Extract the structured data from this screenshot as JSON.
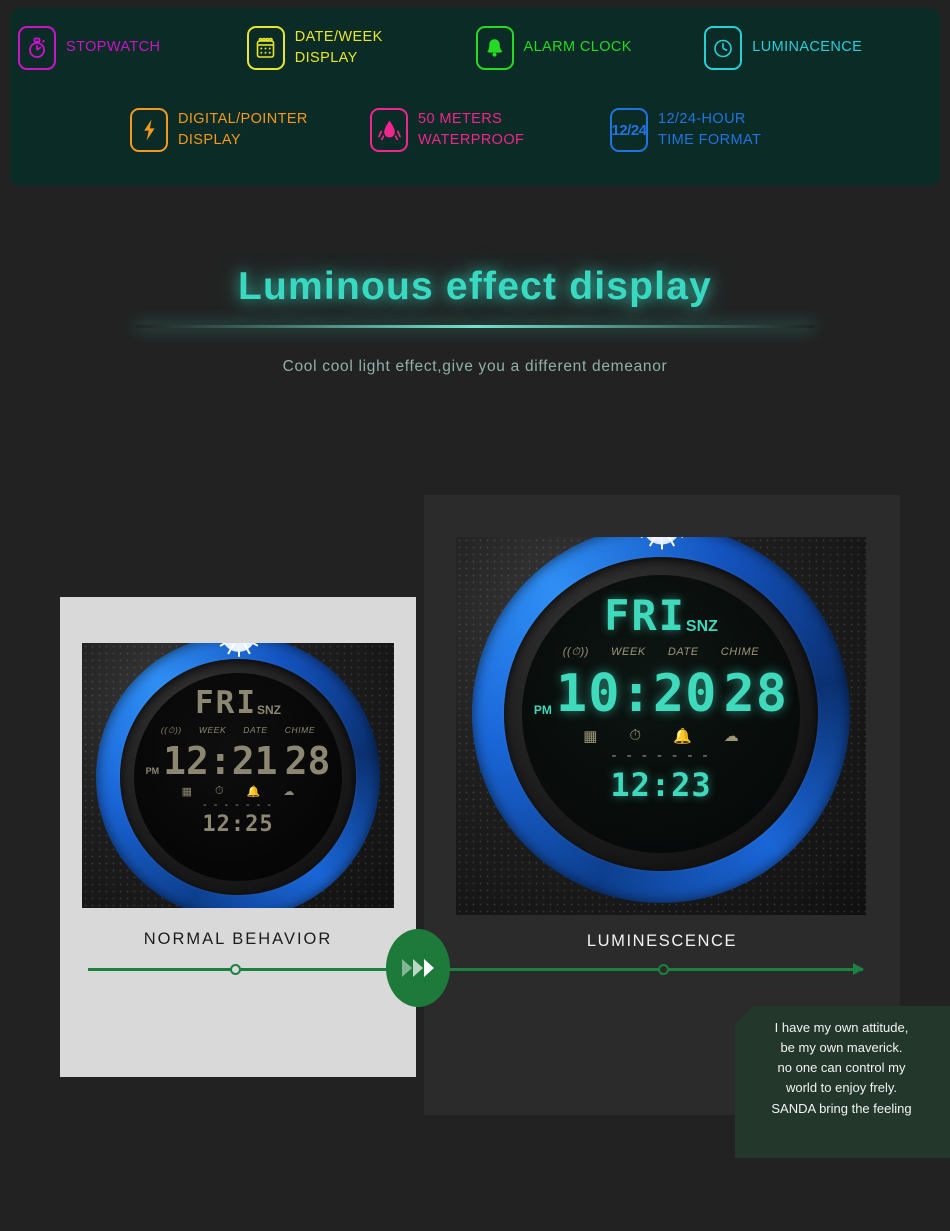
{
  "banner": {
    "features_row1": [
      {
        "icon": "stopwatch-icon",
        "label": "STOPWATCH",
        "color": "#c715c7"
      },
      {
        "icon": "calendar-icon",
        "label": "DATE/WEEK\nDISPLAY",
        "color": "#e8e62a"
      },
      {
        "icon": "bell-icon",
        "label": "ALARM CLOCK",
        "color": "#25d925"
      },
      {
        "icon": "clock-icon",
        "label": "LUMINACENCE",
        "color": "#27cfd6"
      }
    ],
    "features_row2": [
      {
        "icon": "lightning-bolt-icon",
        "label": "DIGITAL/POINTER\nDISPLAY",
        "color": "#f2991f"
      },
      {
        "icon": "water-drop-icon",
        "label": "50 METERS\nWATERPROOF",
        "color": "#f0268c"
      },
      {
        "icon": "twelve-twentyfour-icon",
        "label": "12/24-HOUR\nTIME FORMAT",
        "color": "#1f74e0",
        "icon_text": "12/24"
      }
    ]
  },
  "hero": {
    "title": "Luminous effect display",
    "subtitle": "Cool cool light effect,give you a different demeanor",
    "accent_color": "#38d9c0"
  },
  "comparison": {
    "left": {
      "caption": "NORMAL BEHAVIOR",
      "watch": {
        "day": "FRI",
        "snz": "SNZ",
        "labels": [
          "WEEK",
          "DATE",
          "CHIME"
        ],
        "pm": "PM",
        "time": "12:21",
        "date": "28",
        "sub_time": "12:25",
        "dashes": "- - - - - - -",
        "segment_color": "#8c8770"
      }
    },
    "right": {
      "caption": "LUMINESCENCE",
      "watch": {
        "day": "FRI",
        "snz": "SNZ",
        "labels": [
          "WEEK",
          "DATE",
          "CHIME"
        ],
        "pm": "PM",
        "time": "10:20",
        "date": "28",
        "sub_time": "12:23",
        "dashes": "- - - - - - -",
        "segment_color": "#3fd9bc"
      }
    },
    "track_color": "#1c8040",
    "chevron_button": "chevrons-right-icon"
  },
  "quote": {
    "text": "I have my own attitude,\nbe my own maverick.\nno one can control my\nworld to enjoy frely.\nSANDA bring the feeling"
  }
}
